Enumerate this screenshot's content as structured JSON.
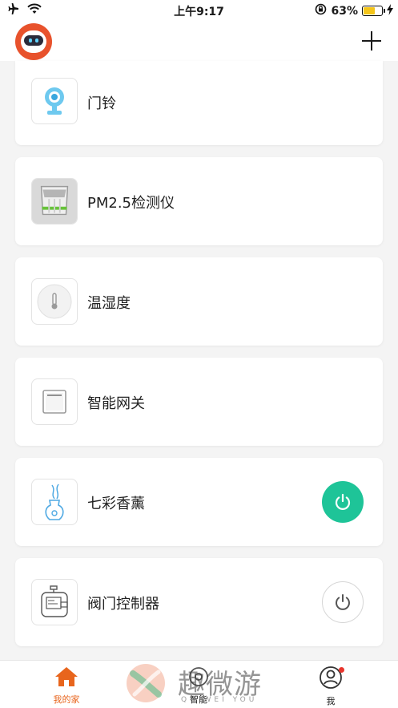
{
  "status_bar": {
    "time": "上午9:17",
    "battery": "63%"
  },
  "devices": [
    {
      "name": "门铃",
      "icon": "camera-doorbell-icon",
      "power": null
    },
    {
      "name": "PM2.5检测仪",
      "icon": "air-monitor-icon",
      "power": null
    },
    {
      "name": "温湿度",
      "icon": "thermometer-icon",
      "power": null
    },
    {
      "name": "智能网关",
      "icon": "gateway-icon",
      "power": null
    },
    {
      "name": "七彩香薰",
      "icon": "aroma-diffuser-icon",
      "power": "on"
    },
    {
      "name": "阀门控制器",
      "icon": "valve-controller-icon",
      "power": "off"
    }
  ],
  "tabs": [
    {
      "label": "我的家",
      "icon": "home-icon",
      "active": true
    },
    {
      "label": "智能",
      "icon": "smart-icon",
      "active": false
    },
    {
      "label": "我",
      "icon": "profile-icon",
      "active": false
    }
  ],
  "watermark": {
    "text": "趣微游",
    "subtext": "QU WEI YOU"
  },
  "colors": {
    "accent": "#e8651d",
    "power_on": "#1ec498",
    "background": "#f4f4f4"
  }
}
